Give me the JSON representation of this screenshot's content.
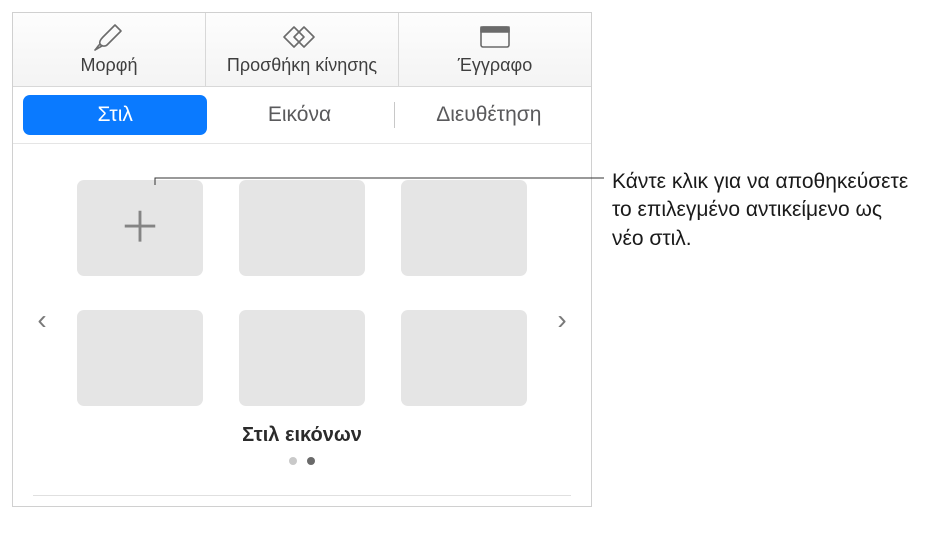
{
  "toolbar": {
    "format": {
      "label": "Μορφή"
    },
    "animate": {
      "label": "Προσθήκη κίνησης"
    },
    "document": {
      "label": "Έγγραφο"
    }
  },
  "tabs": {
    "style": {
      "label": "Στιλ"
    },
    "image": {
      "label": "Εικόνα"
    },
    "arrange": {
      "label": "Διευθέτηση"
    }
  },
  "section": {
    "title": "Στιλ εικόνων"
  },
  "callout": {
    "text": "Κάντε κλικ για να αποθηκεύσετε το επιλεγμένο αντικείμενο ως νέο στιλ."
  }
}
